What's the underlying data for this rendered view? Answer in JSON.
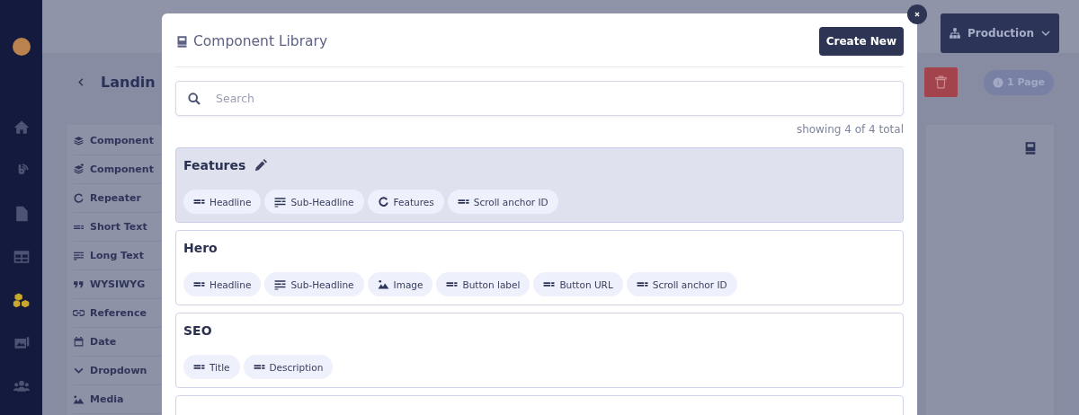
{
  "nav": [
    {
      "kind": "home",
      "selected": false
    },
    {
      "kind": "blog",
      "selected": false
    },
    {
      "kind": "page",
      "selected": false
    },
    {
      "kind": "table",
      "selected": false
    },
    {
      "kind": "components",
      "selected": true
    },
    {
      "kind": "media",
      "selected": false
    },
    {
      "kind": "users",
      "selected": false
    }
  ],
  "environment": {
    "label": "Production"
  },
  "page": {
    "title": "Landin",
    "page_count": "1 Page"
  },
  "field_types": [
    {
      "kind": "layers",
      "label": "Component"
    },
    {
      "kind": "layers-add",
      "label": "Component"
    },
    {
      "kind": "repeater",
      "label": "Repeater"
    },
    {
      "kind": "short",
      "label": "Short Text"
    },
    {
      "kind": "long",
      "label": "Long Text"
    },
    {
      "kind": "quote",
      "label": "WYSIWYG"
    },
    {
      "kind": "link",
      "label": "Reference"
    },
    {
      "kind": "date",
      "label": "Date"
    },
    {
      "kind": "chevron",
      "label": "Dropdown"
    },
    {
      "kind": "image",
      "label": "Media"
    }
  ],
  "modal": {
    "title": "Component Library",
    "create_button": "Create New",
    "search": {
      "placeholder": "Search"
    },
    "count": "showing 4 of 4 total",
    "components": [
      {
        "name": "Features",
        "selected": true,
        "fields": [
          {
            "kind": "short",
            "label": "Headline"
          },
          {
            "kind": "long",
            "label": "Sub-Headline"
          },
          {
            "kind": "repeater",
            "label": "Features"
          },
          {
            "kind": "short",
            "label": "Scroll anchor ID"
          }
        ]
      },
      {
        "name": "Hero",
        "selected": false,
        "fields": [
          {
            "kind": "short",
            "label": "Headline"
          },
          {
            "kind": "long",
            "label": "Sub-Headline"
          },
          {
            "kind": "image",
            "label": "Image"
          },
          {
            "kind": "short",
            "label": "Button label"
          },
          {
            "kind": "short",
            "label": "Button URL"
          },
          {
            "kind": "short",
            "label": "Scroll anchor ID"
          }
        ]
      },
      {
        "name": "SEO",
        "selected": false,
        "fields": [
          {
            "kind": "short",
            "label": "Title"
          },
          {
            "kind": "short",
            "label": "Description"
          }
        ]
      }
    ]
  }
}
